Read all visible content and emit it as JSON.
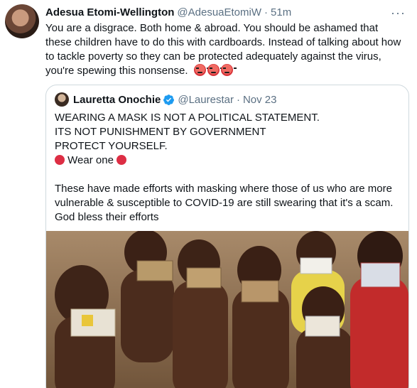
{
  "tweet": {
    "author_name": "Adesua Etomi-Wellington",
    "author_handle": "@AdesuaEtomiW",
    "separator": "·",
    "time": "51m",
    "more_label": "···",
    "text": "You are a disgrace. Both home & abroad. You should be ashamed that these children have to do this with cardboards. Instead of talking about how to tackle poverty so they can be protected adequately against the virus, you're spewing this nonsense.",
    "emoji": [
      "angry-face-icon",
      "angry-face-icon",
      "angry-face-icon"
    ]
  },
  "quote": {
    "author_name": "Lauretta Onochie",
    "author_handle": "@Laurestar",
    "separator": "·",
    "time": "Nov 23",
    "verified_color": "#1d9bf0",
    "lines": [
      "WEARING A MASK IS NOT A POLITICAL STATEMENT.",
      "ITS NOT PUNISHMENT BY GOVERNMENT",
      "PROTECT YOURSELF."
    ],
    "wear_one": "Wear one",
    "paragraph2": "These have made efforts with masking where those of us who are more vulnerable & susceptible to COVID-19 are still swearing that it's a scam. God bless their efforts"
  },
  "colors": {
    "text": "#0f1419",
    "secondary": "#5b7083",
    "border": "#cfd9de",
    "emoji_red": "#dd2e44"
  }
}
